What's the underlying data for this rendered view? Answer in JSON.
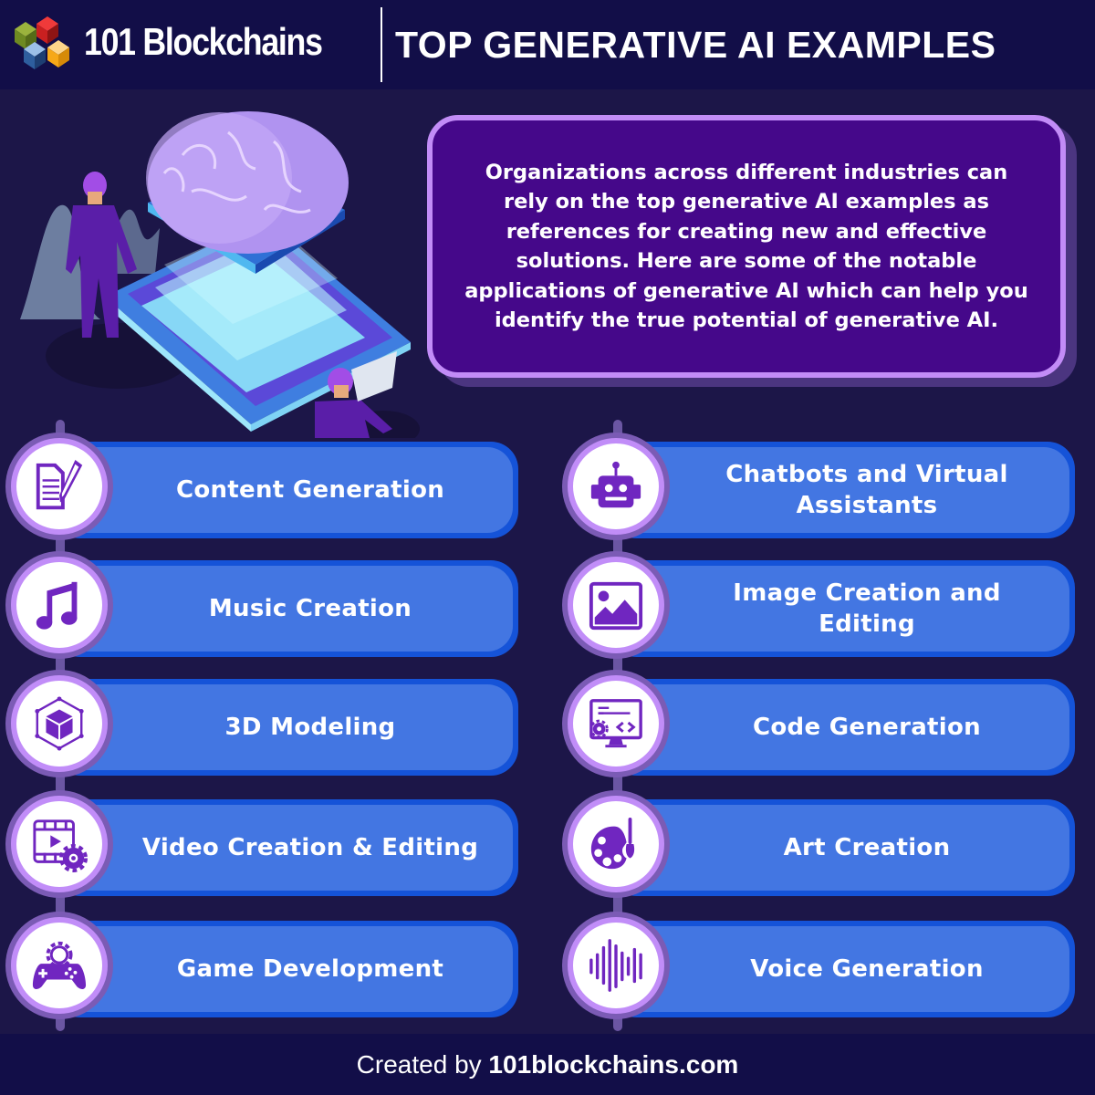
{
  "header": {
    "brand": "101 Blockchains",
    "title": "TOP GENERATIVE AI EXAMPLES"
  },
  "intro": {
    "text": "Organizations across different industries can rely on the top generative AI examples as references for creating new and effective solutions. Here are some of the notable applications of generative AI which can help you identify the true potential of generative AI."
  },
  "colors": {
    "background": "#1c1648",
    "header_bg": "#120e48",
    "intro_bg": "#45088a",
    "intro_border": "#c28cf7",
    "card_blue": "#4376e2",
    "card_border": "#1553d8",
    "icon_purple": "#7026c0",
    "ring_lilac": "#c18df8"
  },
  "items_left": [
    {
      "label": "Content Generation",
      "icon": "document-pencil-icon"
    },
    {
      "label": "Music Creation",
      "icon": "music-note-icon"
    },
    {
      "label": "3D Modeling",
      "icon": "cube-3d-icon"
    },
    {
      "label": "Video Creation & Editing",
      "icon": "video-settings-icon"
    },
    {
      "label": "Game Development",
      "icon": "gamepad-gear-icon"
    }
  ],
  "items_right": [
    {
      "label": "Chatbots and Virtual Assistants",
      "icon": "robot-icon"
    },
    {
      "label": "Image Creation and Editing",
      "icon": "image-icon"
    },
    {
      "label": "Code Generation",
      "icon": "code-monitor-icon"
    },
    {
      "label": "Art Creation",
      "icon": "palette-brush-icon"
    },
    {
      "label": "Voice Generation",
      "icon": "sound-wave-icon"
    }
  ],
  "footer": {
    "prefix": "Created by",
    "site": "101blockchains.com"
  }
}
